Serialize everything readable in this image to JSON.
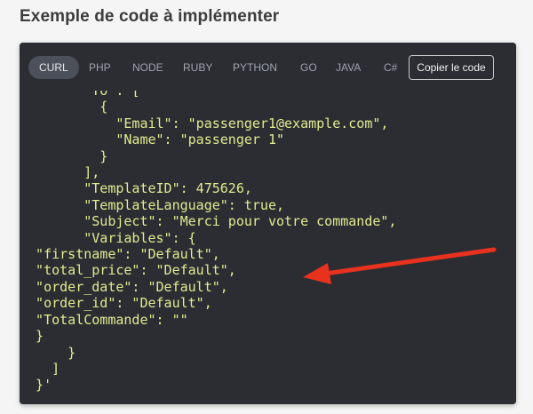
{
  "heading": "Exemple de code à implémenter",
  "tabs": [
    {
      "label": "CURL",
      "active": true
    },
    {
      "label": "PHP"
    },
    {
      "label": "NODE"
    },
    {
      "label": "RUBY"
    },
    {
      "label": "PYTHON"
    },
    {
      "label": "GO"
    },
    {
      "label": "JAVA"
    },
    {
      "label": "C#"
    }
  ],
  "copy_button": "Copier le code",
  "code_lines": [
    "        \"To\": [",
    "          {",
    "            \"Email\": \"passenger1@example.com\",",
    "            \"Name\": \"passenger 1\"",
    "          }",
    "        ],",
    "        \"TemplateID\": 475626,",
    "        \"TemplateLanguage\": true,",
    "        \"Subject\": \"Merci pour votre commande\",",
    "        \"Variables\": {",
    "  \"firstname\": \"Default\",",
    "  \"total_price\": \"Default\",",
    "  \"order_date\": \"Default\",",
    "  \"order_id\": \"Default\",",
    "  \"TotalCommande\": \"\"",
    "  }",
    "      }",
    "    ]",
    "  }'"
  ],
  "colors": {
    "panel_bg": "#2b2d33",
    "code_text": "#e3eb8f",
    "arrow": "#e8321e"
  },
  "icons": {
    "annotation": "red-arrow-icon"
  }
}
